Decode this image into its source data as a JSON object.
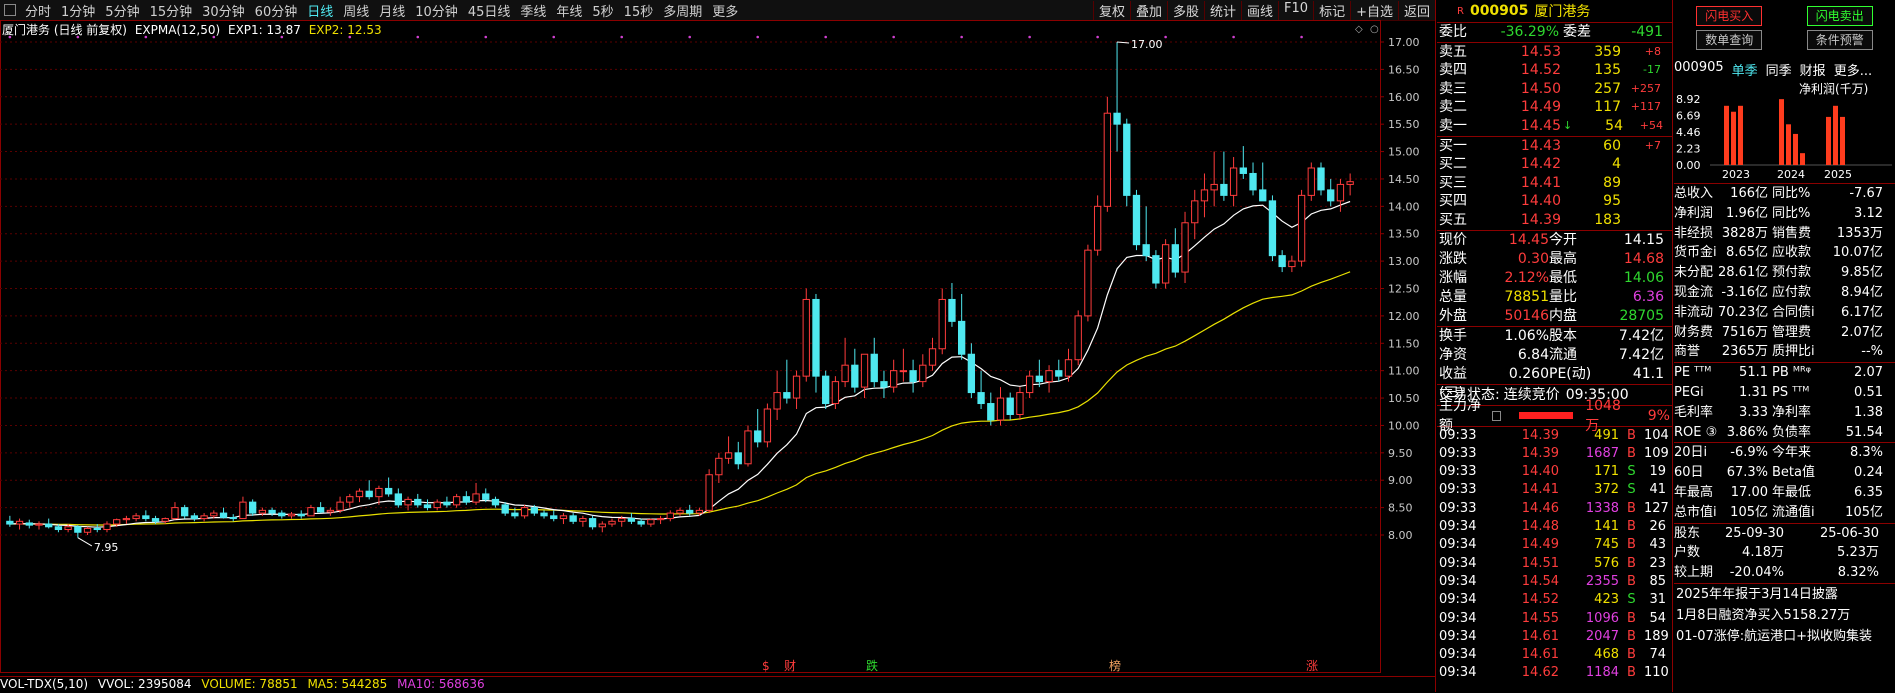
{
  "toolbar": {
    "timeframes": [
      "分时",
      "1分钟",
      "5分钟",
      "15分钟",
      "30分钟",
      "60分钟",
      "日线",
      "周线",
      "月线",
      "10分钟",
      "45日线",
      "季线",
      "年线",
      "5秒",
      "15秒",
      "多周期",
      "更多"
    ],
    "active": "日线",
    "right_buttons": [
      "复权",
      "叠加",
      "多股",
      "统计",
      "画线",
      "F10",
      "标记",
      "+自选",
      "返回"
    ]
  },
  "chart": {
    "stock_label": "厦门港务 (日线 前复权)",
    "indicator": "EXPMA(12,50)",
    "exp1": "EXP1: 13.87",
    "exp2": "EXP2: 12.53",
    "high_mark": "17.00",
    "low_mark": "7.95",
    "markers": [
      "$",
      "财",
      "跌",
      "榜",
      "涨"
    ]
  },
  "chart_data": {
    "type": "candlestick",
    "y_ticks": [
      "17.00",
      "16.50",
      "16.00",
      "15.50",
      "15.00",
      "14.50",
      "14.00",
      "13.50",
      "13.00",
      "12.50",
      "12.00",
      "11.50",
      "11.00",
      "10.50",
      "10.00",
      "9.50",
      "9.00",
      "8.50",
      "8.00"
    ],
    "ylim": [
      7.7,
      17.2
    ],
    "ohlc_note": "approximate daily candles read from figure",
    "candles": [
      [
        8.25,
        8.35,
        8.15,
        8.2
      ],
      [
        8.2,
        8.3,
        8.1,
        8.25
      ],
      [
        8.22,
        8.28,
        8.12,
        8.18
      ],
      [
        8.18,
        8.25,
        8.1,
        8.2
      ],
      [
        8.2,
        8.3,
        8.12,
        8.15
      ],
      [
        8.15,
        8.2,
        8.05,
        8.1
      ],
      [
        8.1,
        8.2,
        8.05,
        8.15
      ],
      [
        8.15,
        8.18,
        7.95,
        8.05
      ],
      [
        8.05,
        8.15,
        8.0,
        8.12
      ],
      [
        8.12,
        8.2,
        8.05,
        8.1
      ],
      [
        8.1,
        8.25,
        8.05,
        8.2
      ],
      [
        8.2,
        8.3,
        8.15,
        8.28
      ],
      [
        8.28,
        8.35,
        8.2,
        8.3
      ],
      [
        8.3,
        8.4,
        8.25,
        8.35
      ],
      [
        8.35,
        8.45,
        8.25,
        8.3
      ],
      [
        8.3,
        8.35,
        8.2,
        8.25
      ],
      [
        8.25,
        8.32,
        8.2,
        8.3
      ],
      [
        8.3,
        8.6,
        8.28,
        8.5
      ],
      [
        8.5,
        8.55,
        8.3,
        8.35
      ],
      [
        8.35,
        8.4,
        8.25,
        8.3
      ],
      [
        8.3,
        8.4,
        8.25,
        8.35
      ],
      [
        8.35,
        8.45,
        8.3,
        8.4
      ],
      [
        8.4,
        8.5,
        8.3,
        8.32
      ],
      [
        8.32,
        8.38,
        8.25,
        8.3
      ],
      [
        8.3,
        8.7,
        8.3,
        8.6
      ],
      [
        8.6,
        8.65,
        8.35,
        8.4
      ],
      [
        8.4,
        8.5,
        8.35,
        8.45
      ],
      [
        8.45,
        8.5,
        8.35,
        8.4
      ],
      [
        8.4,
        8.45,
        8.3,
        8.35
      ],
      [
        8.35,
        8.42,
        8.3,
        8.38
      ],
      [
        8.38,
        8.45,
        8.3,
        8.35
      ],
      [
        8.35,
        8.55,
        8.35,
        8.5
      ],
      [
        8.5,
        8.6,
        8.4,
        8.42
      ],
      [
        8.42,
        8.5,
        8.35,
        8.45
      ],
      [
        8.45,
        8.7,
        8.4,
        8.6
      ],
      [
        8.6,
        8.75,
        8.5,
        8.7
      ],
      [
        8.7,
        8.85,
        8.6,
        8.8
      ],
      [
        8.8,
        9.0,
        8.65,
        8.7
      ],
      [
        8.7,
        8.9,
        8.55,
        8.85
      ],
      [
        8.85,
        9.05,
        8.7,
        8.75
      ],
      [
        8.75,
        8.85,
        8.5,
        8.55
      ],
      [
        8.55,
        8.7,
        8.45,
        8.65
      ],
      [
        8.65,
        8.75,
        8.5,
        8.55
      ],
      [
        8.55,
        8.65,
        8.45,
        8.5
      ],
      [
        8.5,
        8.65,
        8.45,
        8.6
      ],
      [
        8.6,
        8.7,
        8.5,
        8.55
      ],
      [
        8.55,
        8.75,
        8.5,
        8.7
      ],
      [
        8.7,
        8.8,
        8.55,
        8.6
      ],
      [
        8.6,
        8.95,
        8.55,
        8.75
      ],
      [
        8.75,
        8.85,
        8.6,
        8.65
      ],
      [
        8.65,
        8.7,
        8.5,
        8.55
      ],
      [
        8.55,
        8.6,
        8.35,
        8.4
      ],
      [
        8.4,
        8.5,
        8.3,
        8.35
      ],
      [
        8.35,
        8.55,
        8.3,
        8.5
      ],
      [
        8.5,
        8.55,
        8.35,
        8.4
      ],
      [
        8.4,
        8.45,
        8.3,
        8.35
      ],
      [
        8.35,
        8.45,
        8.25,
        8.3
      ],
      [
        8.3,
        8.4,
        8.2,
        8.35
      ],
      [
        8.35,
        8.4,
        8.2,
        8.25
      ],
      [
        8.25,
        8.35,
        8.15,
        8.3
      ],
      [
        8.3,
        8.35,
        8.1,
        8.15
      ],
      [
        8.15,
        8.25,
        8.05,
        8.2
      ],
      [
        8.2,
        8.3,
        8.15,
        8.25
      ],
      [
        8.25,
        8.35,
        8.15,
        8.3
      ],
      [
        8.3,
        8.4,
        8.2,
        8.25
      ],
      [
        8.25,
        8.3,
        8.15,
        8.2
      ],
      [
        8.2,
        8.3,
        8.15,
        8.28
      ],
      [
        8.28,
        8.35,
        8.2,
        8.3
      ],
      [
        8.3,
        8.45,
        8.25,
        8.4
      ],
      [
        8.4,
        8.5,
        8.35,
        8.45
      ],
      [
        8.45,
        8.55,
        8.35,
        8.4
      ],
      [
        8.4,
        8.5,
        8.35,
        8.45
      ],
      [
        8.45,
        9.2,
        8.4,
        9.1
      ],
      [
        9.1,
        9.5,
        8.95,
        9.4
      ],
      [
        9.4,
        9.8,
        9.3,
        9.5
      ],
      [
        9.5,
        9.7,
        9.2,
        9.3
      ],
      [
        9.3,
        10.0,
        9.25,
        9.9
      ],
      [
        9.9,
        10.3,
        9.6,
        9.7
      ],
      [
        9.7,
        10.4,
        9.6,
        10.3
      ],
      [
        10.3,
        11.0,
        10.1,
        10.6
      ],
      [
        10.6,
        11.2,
        10.4,
        10.5
      ],
      [
        10.5,
        11.0,
        10.3,
        10.9
      ],
      [
        10.9,
        12.5,
        10.8,
        12.3
      ],
      [
        12.3,
        12.4,
        10.6,
        10.9
      ],
      [
        10.9,
        11.0,
        10.3,
        10.4
      ],
      [
        10.4,
        10.9,
        10.3,
        10.8
      ],
      [
        10.8,
        11.6,
        10.7,
        11.1
      ],
      [
        11.1,
        11.4,
        10.6,
        10.7
      ],
      [
        10.7,
        11.3,
        10.5,
        11.3
      ],
      [
        11.3,
        11.6,
        10.7,
        10.8
      ],
      [
        10.8,
        11.0,
        10.5,
        10.7
      ],
      [
        10.7,
        11.2,
        10.6,
        11.0
      ],
      [
        11.0,
        11.4,
        10.8,
        11.0
      ],
      [
        11.0,
        11.2,
        10.6,
        10.8
      ],
      [
        10.8,
        11.3,
        10.7,
        11.1
      ],
      [
        11.1,
        11.6,
        11.0,
        11.4
      ],
      [
        11.4,
        12.5,
        11.3,
        12.3
      ],
      [
        12.3,
        12.6,
        11.8,
        11.9
      ],
      [
        11.9,
        12.4,
        11.2,
        11.3
      ],
      [
        11.3,
        11.5,
        10.5,
        10.6
      ],
      [
        10.6,
        11.0,
        10.3,
        10.4
      ],
      [
        10.4,
        10.6,
        10.0,
        10.1
      ],
      [
        10.1,
        10.7,
        10.0,
        10.5
      ],
      [
        10.5,
        10.6,
        10.1,
        10.2
      ],
      [
        10.2,
        10.7,
        10.1,
        10.6
      ],
      [
        10.6,
        11.0,
        10.5,
        10.9
      ],
      [
        10.9,
        11.2,
        10.7,
        10.8
      ],
      [
        10.8,
        11.1,
        10.6,
        11.0
      ],
      [
        11.0,
        11.2,
        10.8,
        10.9
      ],
      [
        10.9,
        11.4,
        10.8,
        11.2
      ],
      [
        11.2,
        12.1,
        11.1,
        12.0
      ],
      [
        12.0,
        13.3,
        11.9,
        13.2
      ],
      [
        13.2,
        14.2,
        13.1,
        14.0
      ],
      [
        14.0,
        16.0,
        13.9,
        15.7
      ],
      [
        15.7,
        17.0,
        15.0,
        15.5
      ],
      [
        15.5,
        15.6,
        14.0,
        14.2
      ],
      [
        14.2,
        14.3,
        13.2,
        13.3
      ],
      [
        13.3,
        14.0,
        13.0,
        13.1
      ],
      [
        13.1,
        13.2,
        12.5,
        12.6
      ],
      [
        12.6,
        13.4,
        12.5,
        13.3
      ],
      [
        13.3,
        13.6,
        12.7,
        12.8
      ],
      [
        12.8,
        13.9,
        12.6,
        13.7
      ],
      [
        13.7,
        14.3,
        13.4,
        14.1
      ],
      [
        14.1,
        14.6,
        13.8,
        14.3
      ],
      [
        14.3,
        15.0,
        14.0,
        14.4
      ],
      [
        14.4,
        15.0,
        14.1,
        14.2
      ],
      [
        14.2,
        14.9,
        14.0,
        14.7
      ],
      [
        14.7,
        15.1,
        14.5,
        14.6
      ],
      [
        14.6,
        14.8,
        14.2,
        14.3
      ],
      [
        14.3,
        14.8,
        14.1,
        14.1
      ],
      [
        14.1,
        14.2,
        13.0,
        13.1
      ],
      [
        13.1,
        13.2,
        12.8,
        12.9
      ],
      [
        12.9,
        13.1,
        12.8,
        13.0
      ],
      [
        13.0,
        14.3,
        12.9,
        14.2
      ],
      [
        14.2,
        14.8,
        14.1,
        14.7
      ],
      [
        14.7,
        14.8,
        14.2,
        14.3
      ],
      [
        14.3,
        14.5,
        14.0,
        14.1
      ],
      [
        14.1,
        14.5,
        13.9,
        14.4
      ],
      [
        14.4,
        14.6,
        14.2,
        14.45
      ]
    ],
    "exp1_curve": "white line (EXPMA 12) following candles",
    "exp2_curve": "yellow line (EXPMA 50) smoother trend"
  },
  "quote": {
    "r_badge": "R",
    "code": "000905",
    "name": "厦门港务",
    "webi_label": "委比",
    "webi_value": "-36.29%",
    "weicha_label": "委差",
    "weicha_value": "-491",
    "asks": [
      {
        "label": "卖五",
        "price": "14.53",
        "vol": "359",
        "chg": "+8"
      },
      {
        "label": "卖四",
        "price": "14.52",
        "vol": "135",
        "chg": "-17"
      },
      {
        "label": "卖三",
        "price": "14.50",
        "vol": "257",
        "chg": "+257"
      },
      {
        "label": "卖二",
        "price": "14.49",
        "vol": "117",
        "chg": "+117"
      },
      {
        "label": "卖一",
        "price": "14.45",
        "vol": "54",
        "chg": "+54",
        "arrow": "↓"
      }
    ],
    "bids": [
      {
        "label": "买一",
        "price": "14.43",
        "vol": "60",
        "chg": "+7"
      },
      {
        "label": "买二",
        "price": "14.42",
        "vol": "4",
        "chg": ""
      },
      {
        "label": "买三",
        "price": "14.41",
        "vol": "89",
        "chg": ""
      },
      {
        "label": "买四",
        "price": "14.40",
        "vol": "95",
        "chg": ""
      },
      {
        "label": "买五",
        "price": "14.39",
        "vol": "183",
        "chg": ""
      }
    ],
    "stats": [
      [
        "现价",
        "14.45",
        "今开",
        "14.15"
      ],
      [
        "涨跌",
        "0.30",
        "最高",
        "14.68"
      ],
      [
        "涨幅",
        "2.12%",
        "最低",
        "14.06"
      ],
      [
        "总量",
        "78851",
        "量比",
        "6.36"
      ],
      [
        "外盘",
        "50146",
        "内盘",
        "28705"
      ]
    ],
    "stats2": [
      [
        "换手",
        "1.06%",
        "股本",
        "7.42亿"
      ],
      [
        "净资",
        "6.84",
        "流通",
        "7.42亿"
      ],
      [
        "收益(三)",
        "0.260",
        "PE(动)",
        "41.1"
      ]
    ],
    "status_label": "交易状态:",
    "status_value": "连续竞价",
    "status_time": "09:35:00",
    "flow_label": "主力净额",
    "flow_value": "1048万",
    "flow_pct": "9%",
    "ticks": [
      [
        "09:33",
        "14.39",
        "491",
        "B",
        "104"
      ],
      [
        "09:33",
        "14.39",
        "1687",
        "B",
        "109"
      ],
      [
        "09:33",
        "14.40",
        "171",
        "S",
        "19"
      ],
      [
        "09:33",
        "14.41",
        "372",
        "S",
        "41"
      ],
      [
        "09:33",
        "14.46",
        "1338",
        "B",
        "127"
      ],
      [
        "09:34",
        "14.48",
        "141",
        "B",
        "26"
      ],
      [
        "09:34",
        "14.49",
        "745",
        "B",
        "43"
      ],
      [
        "09:34",
        "14.51",
        "576",
        "B",
        "23"
      ],
      [
        "09:34",
        "14.54",
        "2355",
        "B",
        "85"
      ],
      [
        "09:34",
        "14.52",
        "423",
        "S",
        "31"
      ],
      [
        "09:34",
        "14.55",
        "1096",
        "B",
        "54"
      ],
      [
        "09:34",
        "14.61",
        "2047",
        "B",
        "189"
      ],
      [
        "09:34",
        "14.61",
        "468",
        "B",
        "74"
      ],
      [
        "09:34",
        "14.62",
        "1184",
        "B",
        "110"
      ]
    ]
  },
  "info": {
    "btn_flash_buy": "闪电买入",
    "btn_flash_sell": "闪电卖出",
    "btn_data_query": "数单查询",
    "btn_alert": "条件预警",
    "code": "000905",
    "tab_single": "单季",
    "tab_same": "同季",
    "tab_fin": "财报",
    "tab_more": "更多...",
    "profit_label": "净利润(千万)",
    "bar_yticks": [
      "8.92",
      "6.69",
      "4.46",
      "2.23",
      "0.00"
    ],
    "bar_years": [
      "2023",
      "2024",
      "2025"
    ],
    "fin_bars": [
      [
        8.0,
        7.2,
        8.0
      ],
      [
        8.9,
        5.5,
        4.2,
        1.6
      ],
      [
        6.5,
        8.0,
        6.5
      ]
    ],
    "rows": [
      [
        "总收入",
        "166亿",
        "同比%",
        "-7.67"
      ],
      [
        "净利润",
        "1.96亿",
        "同比%",
        "3.12"
      ],
      [
        "非经损",
        "3828万",
        "销售费",
        "1353万"
      ],
      [
        "货币金i",
        "8.65亿",
        "应收款",
        "10.07亿"
      ],
      [
        "未分配",
        "28.61亿",
        "预付款",
        "9.85亿"
      ],
      [
        "现金流",
        "-3.16亿",
        "应付款",
        "8.94亿"
      ],
      [
        "非流动",
        "70.23亿",
        "合同债i",
        "6.17亿"
      ],
      [
        "财务费",
        "7516万",
        "管理费",
        "2.07亿"
      ],
      [
        "商誉",
        "2365万",
        "质押比i",
        "--%"
      ]
    ],
    "rows2": [
      [
        "PE ᵀᵀᴹ",
        "51.1",
        "PB ᴹᴿᵠ",
        "2.07"
      ],
      [
        "PEGi",
        "1.31",
        "PS ᵀᵀᴹ",
        "0.51"
      ],
      [
        "毛利率",
        "3.33",
        "净利率",
        "1.38"
      ],
      [
        "ROE ③",
        "3.86%",
        "负债率",
        "51.54"
      ]
    ],
    "rows3": [
      [
        "20日i",
        "-6.9%",
        "今年来",
        "8.3%"
      ],
      [
        "60日",
        "67.3%",
        "Beta值",
        "0.24"
      ],
      [
        "年最高",
        "17.00",
        "年最低",
        "6.35"
      ],
      [
        "总市值i",
        "105亿",
        "流通值i",
        "105亿"
      ]
    ],
    "rows4": [
      [
        "股东",
        "25-09-30",
        "",
        "25-06-30"
      ],
      [
        "户数",
        "4.18万",
        "",
        "5.23万"
      ],
      [
        "较上期",
        "-20.04%",
        "",
        "8.32%"
      ]
    ],
    "note1": "2025年年报于3月14日披露",
    "note2": "1月8日融资净买入5158.27万",
    "note3": "01-07涨停:航运港口+拟收购集装"
  },
  "vol": {
    "label": "VOL-TDX(5,10)",
    "vvol": "VVOL: 2395084",
    "volume": "VOLUME: 78851",
    "ma5": "MA5: 544285",
    "ma10": "MA10: 568636"
  }
}
